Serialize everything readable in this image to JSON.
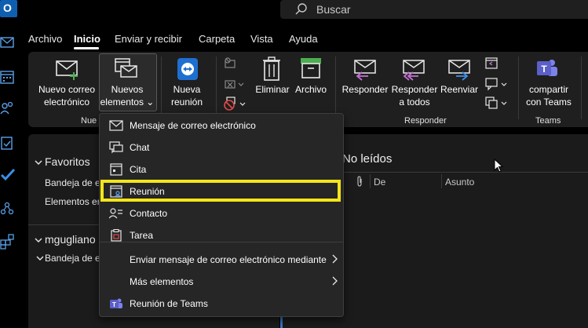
{
  "app": {
    "logo_letter": "O"
  },
  "search": {
    "placeholder": "Buscar"
  },
  "menu_tabs": [
    "Archivo",
    "Inicio",
    "Enviar y recibir",
    "Carpeta",
    "Vista",
    "Ayuda"
  ],
  "ribbon": {
    "nuevo_correo": [
      "Nuevo correo",
      "electrónico"
    ],
    "nuevos_elementos": [
      "Nuevos",
      "elementos ⌄"
    ],
    "nueva_reunion": [
      "Nueva",
      "reunión"
    ],
    "eliminar": "Eliminar",
    "archivo": "Archivo",
    "responder": "Responder",
    "responder_todos": [
      "Responder",
      "a todos"
    ],
    "reenviar": "Reenviar",
    "compartir_teams": [
      "compartir",
      "con Teams"
    ],
    "groups": {
      "nuevo_partial": "Nue",
      "responder": "Responder",
      "teams": "Teams"
    }
  },
  "folders": {
    "favoritos": "Favoritos",
    "bandeja_truncated": "Bandeja de er",
    "elementos_truncated": "Elementos er",
    "account_truncated": "mgugliano",
    "account_bandeja_truncated": "Bandeja de er"
  },
  "list": {
    "heading": "No leídos",
    "col_de": "De",
    "col_asunto": "Asunto"
  },
  "dropdown": {
    "items": [
      {
        "label": "Mensaje de correo electrónico",
        "icon": "mail-icon"
      },
      {
        "label": "Chat",
        "icon": "chat-icon"
      },
      {
        "label": "Cita",
        "icon": "appointment-icon"
      },
      {
        "label": "Reunión",
        "icon": "meeting-icon"
      },
      {
        "label": "Contacto",
        "icon": "contact-icon"
      },
      {
        "label": "Tarea",
        "icon": "task-icon"
      },
      {
        "label": "Enviar mensaje de correo electrónico mediante",
        "icon": "",
        "submenu": true
      },
      {
        "label": "Más elementos",
        "icon": "",
        "submenu": true
      },
      {
        "label": "Reunión de Teams",
        "icon": "teams-icon"
      }
    ]
  },
  "colors": {
    "highlight": "#f3e51a",
    "accent_blue": "#3a78c2",
    "teams_purple": "#5b5fc7",
    "archive_green": "#4caf50"
  }
}
